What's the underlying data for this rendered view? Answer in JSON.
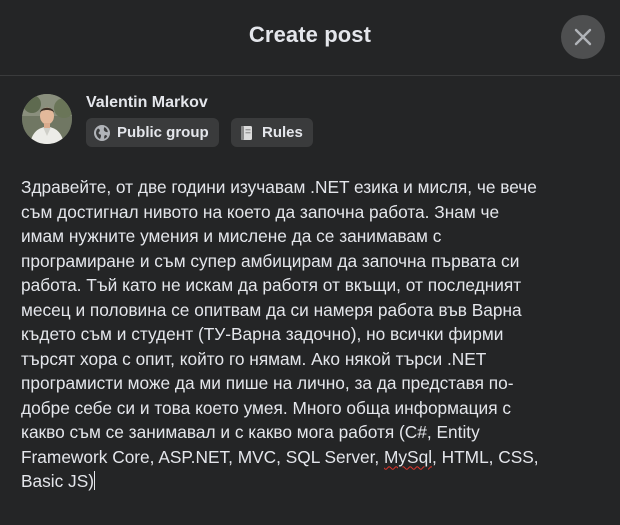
{
  "dialog": {
    "title": "Create post",
    "close_icon": "close-icon"
  },
  "author": {
    "name": "Valentin Markov",
    "audience_label": "Public group",
    "audience_icon": "globe-icon",
    "rules_label": "Rules",
    "rules_icon": "book-icon"
  },
  "post": {
    "lines": [
      "Здравейте, от две години изучавам .NET езика и мисля, че вече",
      "съм достигнал нивото на което да започна работа. Знам че",
      "имам нужните умения и мислене да се занимавам с",
      "програмиране и съм супер амбицирам да започна първата си",
      "работа. Тъй като не искам да работя от вкъщи, от последният",
      "месец и половина се опитвам да си намеря работа във Варна",
      "където съм и студент (ТУ-Варна задочно), но всички фирми",
      "търсят хора с опит, който го нямам. Ако някой търси .NET",
      "програмисти може да ми пише на лично, за да представя по-",
      "добре себе си и това което умея. Много обща информация с",
      "какво съм се занимавал и с какво мога работя (C#, Entity"
    ],
    "line12_before": "Framework Core, ASP.NET, MVC, SQL Server, ",
    "line12_misspelled": "MySql",
    "line12_after": ", HTML, CSS,",
    "line13": "Basic JS)"
  },
  "colors": {
    "background": "#242526",
    "text": "#e4e6eb",
    "chip": "#3a3b3c",
    "close_button": "#4e4f50",
    "spellcheck": "#e0352b"
  }
}
